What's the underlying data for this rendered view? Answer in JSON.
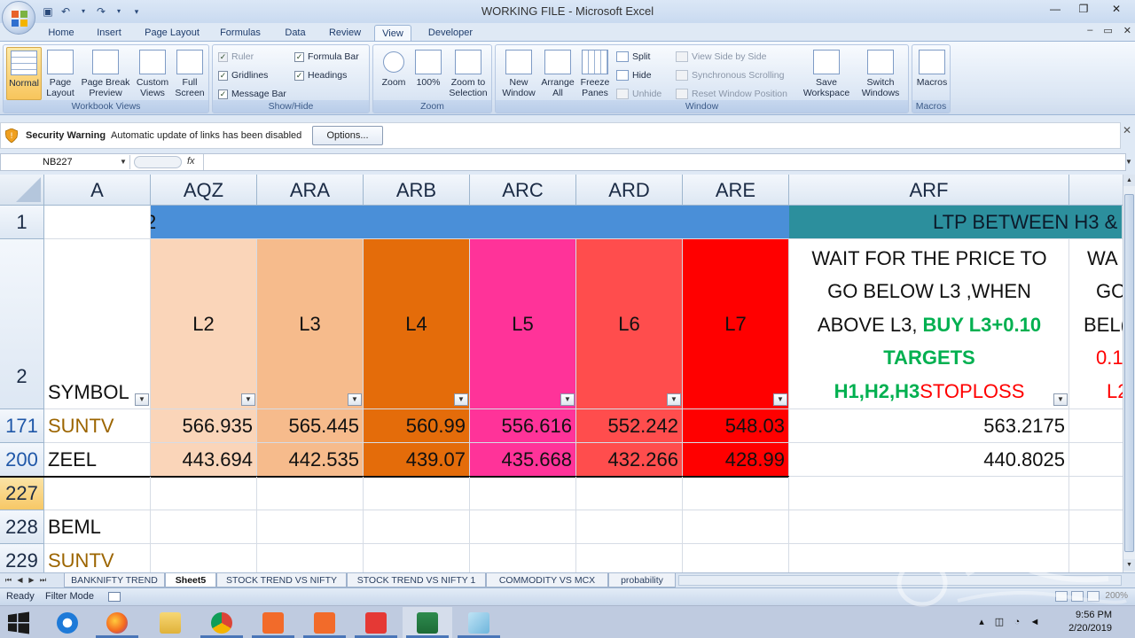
{
  "app": {
    "title": "WORKING FILE - Microsoft Excel"
  },
  "ribbon_tabs": [
    "Home",
    "Insert",
    "Page Layout",
    "Formulas",
    "Data",
    "Review",
    "View",
    "Developer"
  ],
  "active_tab": "View",
  "groups": {
    "workbook_views": {
      "label": "Workbook Views",
      "buttons": [
        "Normal",
        "Page Layout",
        "Page Break Preview",
        "Custom Views",
        "Full Screen"
      ]
    },
    "show_hide": {
      "label": "Show/Hide",
      "checks": [
        {
          "label": "Ruler",
          "checked": false,
          "disabled": true
        },
        {
          "label": "Formula Bar",
          "checked": true
        },
        {
          "label": "Gridlines",
          "checked": true
        },
        {
          "label": "Headings",
          "checked": true
        },
        {
          "label": "Message Bar",
          "checked": true
        }
      ]
    },
    "zoom": {
      "label": "Zoom",
      "buttons": [
        "Zoom",
        "100%",
        "Zoom to Selection"
      ]
    },
    "window": {
      "label": "Window",
      "buttons": [
        "New Window",
        "Arrange All",
        "Freeze Panes"
      ],
      "small": [
        "Split",
        "Hide",
        "Unhide"
      ],
      "small2": [
        "View Side by Side",
        "Synchronous Scrolling",
        "Reset Window Position"
      ],
      "buttons2": [
        "Save Workspace",
        "Switch Windows"
      ]
    },
    "macros": {
      "label": "Macros",
      "buttons": [
        "Macros"
      ]
    }
  },
  "security": {
    "title": "Security Warning",
    "message": "Automatic update of links has been disabled",
    "button": "Options..."
  },
  "formula_bar": {
    "name_box": "NB227",
    "fx": "fx",
    "value": ""
  },
  "grid": {
    "columns": [
      "A",
      "AQZ",
      "ARA",
      "ARB",
      "ARC",
      "ARD",
      "ARE",
      "ARF"
    ],
    "rows": [
      "1",
      "2",
      "171",
      "200",
      "227",
      "228",
      "229"
    ],
    "row1_left_fragment": "2",
    "row1_right_text": "LTP BETWEEN H3 &",
    "headers_row2": {
      "symbol": "SYMBOL",
      "levels": [
        "L2",
        "L3",
        "L4",
        "L5",
        "L6",
        "L7"
      ]
    },
    "arf_lines": {
      "line1": "WAIT FOR THE PRICE TO",
      "line2": "GO BELOW L3 ,WHEN",
      "line3_black": "ABOVE L3, ",
      "line3_green": "BUY L3+0.10",
      "line4_green": "TARGETS",
      "line5_green": "H1,H2,H3",
      "line5_red": "STOPLOSS"
    },
    "next_col_fragments": {
      "l1": "WA",
      "l2": "GO A",
      "l3": "BEL(",
      "l4": "0.1",
      "l5": "L2"
    },
    "data_rows": [
      {
        "row": "171",
        "symbol": "SUNTV",
        "values": [
          "566.935",
          "565.445",
          "560.99",
          "556.616",
          "552.242",
          "548.03"
        ],
        "arf": "563.2175"
      },
      {
        "row": "200",
        "symbol": "ZEEL",
        "values": [
          "443.694",
          "442.535",
          "439.07",
          "435.668",
          "432.266",
          "428.99"
        ],
        "arf": "440.8025"
      },
      {
        "row": "227",
        "symbol": "",
        "values": [
          "",
          "",
          "",
          "",
          "",
          ""
        ],
        "arf": ""
      },
      {
        "row": "228",
        "symbol": "BEML",
        "values": [
          "",
          "",
          "",
          "",
          "",
          ""
        ],
        "arf": ""
      },
      {
        "row": "229",
        "symbol": "SUNTV",
        "values": [
          "",
          "",
          "",
          "",
          "",
          ""
        ],
        "arf": ""
      }
    ],
    "colors": {
      "row1_blue": "#4a8fd8",
      "row1_teal": "#2c8f9d",
      "l2": "#fad5b9",
      "l3": "#f6bb8c",
      "l4": "#e46c0a",
      "l5": "#ff3399",
      "l6": "#ff4d4d",
      "l7": "#ff0000",
      "gold_text": "#9c6500",
      "green_text": "#00b050",
      "red_text": "#ff0000"
    }
  },
  "sheets": [
    "BANKNIFTY TREND",
    "Sheet5",
    "STOCK TREND VS NIFTY",
    "STOCK TREND VS NIFTY 1",
    "COMMODITY VS MCX",
    "probability"
  ],
  "active_sheet": "Sheet5",
  "status": {
    "ready": "Ready",
    "filter_mode": "Filter Mode",
    "zoom": "200%"
  },
  "taskbar": {
    "time": "9:56 PM",
    "date": "2/20/2019"
  }
}
